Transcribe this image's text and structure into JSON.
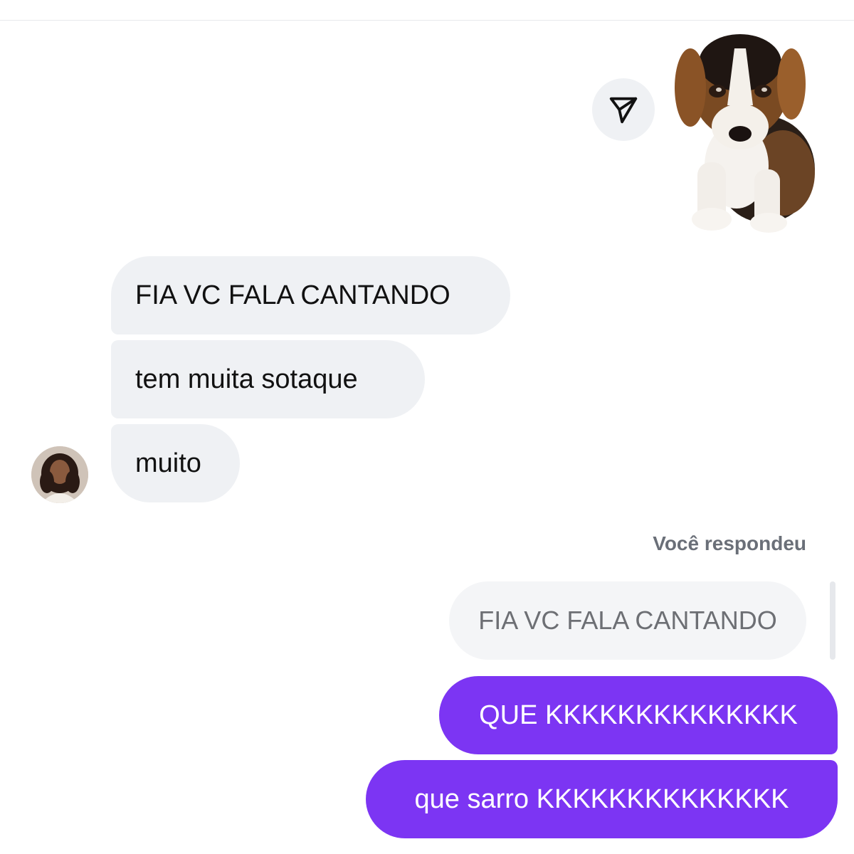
{
  "sticker": {
    "icon": "beagle-puppy-sticker"
  },
  "share": {
    "icon": "send-icon"
  },
  "incoming_messages": [
    {
      "text": "FIA VC FALA CANTANDO"
    },
    {
      "text": "tem muita sotaque"
    },
    {
      "text": "muito"
    }
  ],
  "reply": {
    "label": "Você respondeu",
    "quoted_text": "FIA VC FALA CANTANDO"
  },
  "outgoing_messages": [
    {
      "text": "QUE KKKKKKKKKKKKKK"
    },
    {
      "text": "que sarro KKKKKKKKKKKKKK"
    }
  ],
  "colors": {
    "incoming_bubble": "#eff1f4",
    "outgoing_bubble": "#7c35f3",
    "muted_text": "#6a6f78"
  }
}
